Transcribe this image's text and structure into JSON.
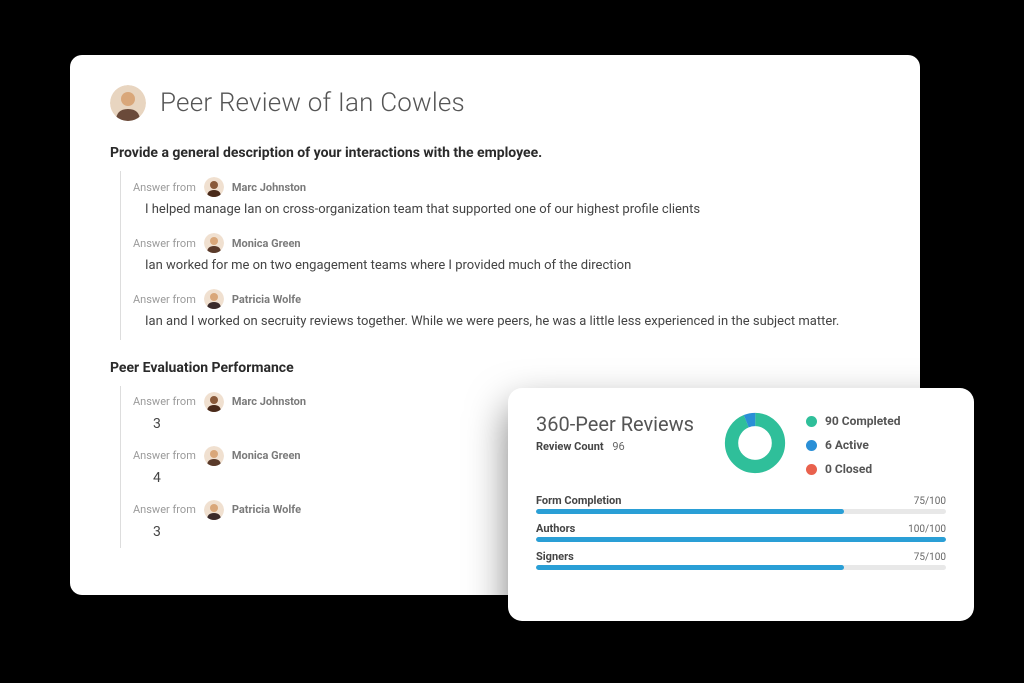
{
  "header": {
    "title": "Peer Review of Ian Cowles",
    "avatar_skin": "#d9a77a"
  },
  "question1": {
    "title": "Provide a general description of your interactions with the employee.",
    "answers": [
      {
        "from_label": "Answer from",
        "name": "Marc Johnston",
        "text": "I helped manage Ian on cross-organization team that supported one of our highest profile clients",
        "skin": "#8a5a3a"
      },
      {
        "from_label": "Answer from",
        "name": "Monica Green",
        "text": "Ian worked for me on two engagement teams where I provided much of the direction",
        "skin": "#d9a77a"
      },
      {
        "from_label": "Answer from",
        "name": "Patricia Wolfe",
        "text": "Ian and I worked on secruity reviews together. While we were peers, he was a little less experienced in the subject matter.",
        "skin": "#d9a77a"
      }
    ]
  },
  "question2": {
    "title": "Peer Evaluation Performance",
    "answers": [
      {
        "from_label": "Answer from",
        "name": "Marc Johnston",
        "score": "3",
        "skin": "#8a5a3a"
      },
      {
        "from_label": "Answer from",
        "name": "Monica Green",
        "score": "4",
        "skin": "#d9a77a"
      },
      {
        "from_label": "Answer from",
        "name": "Patricia Wolfe",
        "score": "3",
        "skin": "#d9a77a"
      }
    ]
  },
  "stats": {
    "title": "360-Peer Reviews",
    "count_label": "Review Count",
    "count_value": "96",
    "legend": {
      "completed": {
        "label": "90 Completed",
        "color": "#2fbf9a"
      },
      "active": {
        "label": "6 Active",
        "color": "#2a8fd6"
      },
      "closed": {
        "label": "0 Closed",
        "color": "#e9614d"
      }
    },
    "progress": [
      {
        "label": "Form Completion",
        "value": "75/100",
        "pct": 75
      },
      {
        "label": "Authors",
        "value": "100/100",
        "pct": 100
      },
      {
        "label": "Signers",
        "value": "75/100",
        "pct": 75
      }
    ]
  },
  "chart_data": {
    "type": "pie",
    "title": "360-Peer Reviews",
    "series": [
      {
        "name": "Completed",
        "value": 90,
        "color": "#2fbf9a"
      },
      {
        "name": "Active",
        "value": 6,
        "color": "#2a8fd6"
      },
      {
        "name": "Closed",
        "value": 0,
        "color": "#e9614d"
      }
    ],
    "total": 96
  }
}
